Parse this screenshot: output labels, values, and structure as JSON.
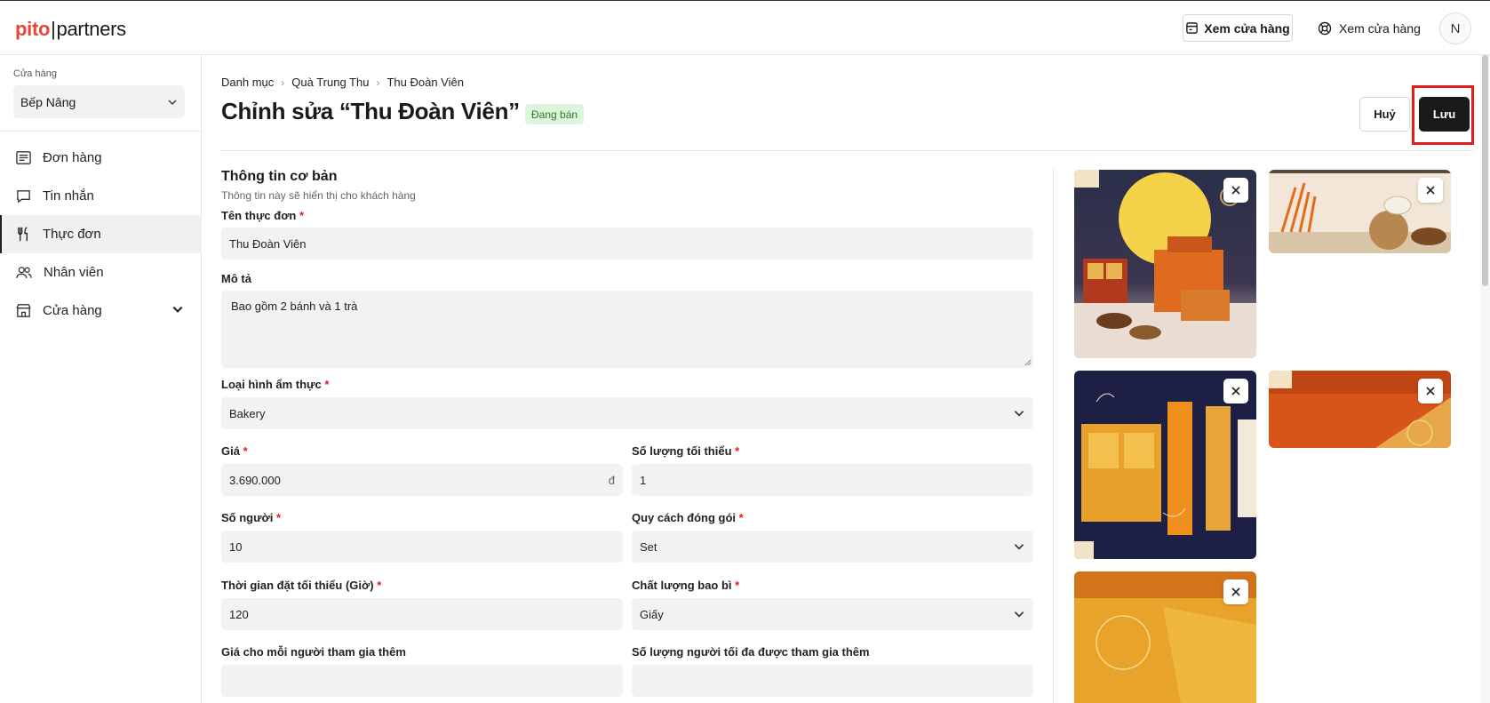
{
  "brand": {
    "logo_left": "pito",
    "logo_sep": "|",
    "logo_right": "partners",
    "accent": "#e8453c"
  },
  "header": {
    "view_store_outline": "Xem cửa hàng",
    "view_store_plain": "Xem cửa hàng",
    "avatar_initial": "N"
  },
  "sidebar": {
    "store_label": "Cửa hàng",
    "store_value": "Bếp Nâng",
    "items": [
      {
        "label": "Đơn hàng",
        "icon": "receipt-icon"
      },
      {
        "label": "Tin nhắn",
        "icon": "chat-icon"
      },
      {
        "label": "Thực đơn",
        "icon": "utensils-icon",
        "active": true
      },
      {
        "label": "Nhân viên",
        "icon": "users-icon"
      },
      {
        "label": "Cửa hàng",
        "icon": "store-icon"
      }
    ]
  },
  "breadcrumb": [
    "Danh mục",
    "Quà Trung Thu",
    "Thu Đoàn Viên"
  ],
  "page": {
    "title": "Chỉnh sửa “Thu Đoàn Viên”",
    "status_badge": "Đang bán",
    "cancel": "Huỷ",
    "save": "Lưu"
  },
  "form": {
    "section_title": "Thông tin cơ bản",
    "section_sub": "Thông tin này sẽ hiển thị cho khách hàng",
    "name_label": "Tên thực đơn",
    "name_value": "Thu Đoàn Viên",
    "desc_label": "Mô tả",
    "desc_value": "Bao gồm 2 bánh và 1 trà",
    "cuisine_label": "Loại hình ẩm thực",
    "cuisine_value": "Bakery",
    "price_label": "Giá",
    "price_value": "3.690.000",
    "price_unit": "đ",
    "min_qty_label": "Số lượng tối thiểu",
    "min_qty_value": "1",
    "people_label": "Số người",
    "people_value": "10",
    "packaging_label": "Quy cách đóng gói",
    "packaging_value": "Set",
    "lead_time_label": "Thời gian đặt tối thiểu (Giờ)",
    "lead_time_value": "120",
    "pack_quality_label": "Chất lượng bao bì",
    "pack_quality_value": "Giấy",
    "extra_price_label": "Giá cho mỗi người tham gia thêm",
    "max_extra_label": "Số lượng người tối đa được tham gia thêm",
    "required_mark": "*"
  }
}
